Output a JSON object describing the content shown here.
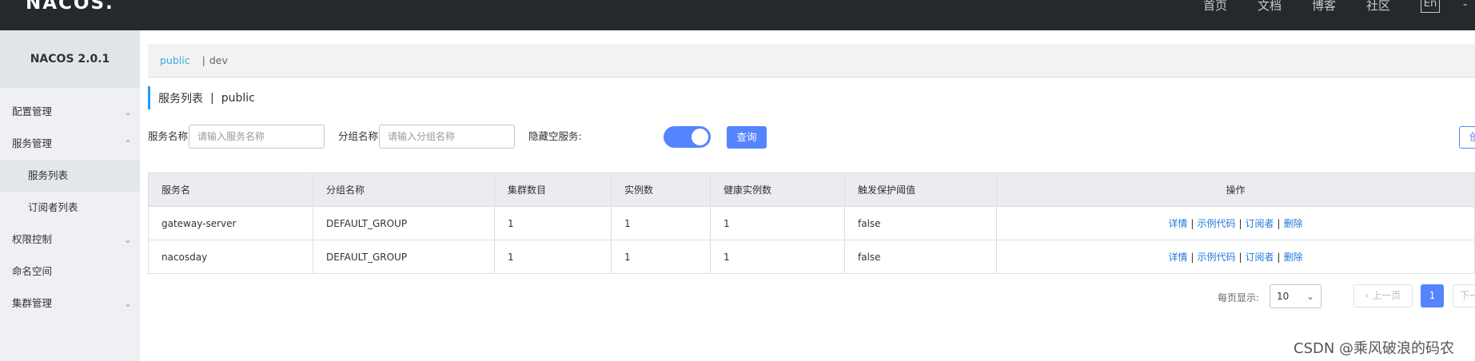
{
  "header": {
    "logo": "NACOS.",
    "nav": [
      "首页",
      "文档",
      "博客",
      "社区"
    ],
    "lang": "En",
    "more": "-"
  },
  "sidebar": {
    "brand": "NACOS 2.0.1",
    "items": [
      {
        "label": "配置管理",
        "chevron": "v"
      },
      {
        "label": "服务管理",
        "chevron": "^"
      },
      {
        "label": "服务列表"
      },
      {
        "label": "订阅者列表"
      },
      {
        "label": "权限控制",
        "chevron": "v"
      },
      {
        "label": "命名空间"
      },
      {
        "label": "集群管理",
        "chevron": "v"
      }
    ]
  },
  "namespace": {
    "active": "public",
    "separator": "|",
    "other": "dev"
  },
  "page_title": {
    "main": "服务列表",
    "separator": "|",
    "namespace": "public"
  },
  "filters": {
    "service_label": "服务名称",
    "service_placeholder": "请输入服务名称",
    "group_label": "分组名称",
    "group_placeholder": "请输入分组名称",
    "hide_empty_label": "隐藏空服务:",
    "hide_empty_on": true,
    "query_button": "查询",
    "create_button": "创建"
  },
  "table": {
    "columns": [
      "服务名",
      "分组名称",
      "集群数目",
      "实例数",
      "健康实例数",
      "触发保护阈值",
      "操作"
    ],
    "rows": [
      {
        "name": "gateway-server",
        "group": "DEFAULT_GROUP",
        "clusters": "1",
        "instances": "1",
        "healthy": "1",
        "protect": "false"
      },
      {
        "name": "nacosday",
        "group": "DEFAULT_GROUP",
        "clusters": "1",
        "instances": "1",
        "healthy": "1",
        "protect": "false"
      }
    ],
    "ops": {
      "detail": "详情",
      "sample": "示例代码",
      "subscriber": "订阅者",
      "delete": "删除",
      "sep": "|"
    }
  },
  "pagination": {
    "page_size_label": "每页显示:",
    "page_size": "10",
    "prev": "上一页",
    "current": "1",
    "next": "下一页"
  },
  "watermark": "CSDN @乘风破浪的码农",
  "colors": {
    "accent": "#5584ff",
    "link": "#2277dd",
    "namespace": "#2eb0d5",
    "topbar": "#25292e"
  }
}
